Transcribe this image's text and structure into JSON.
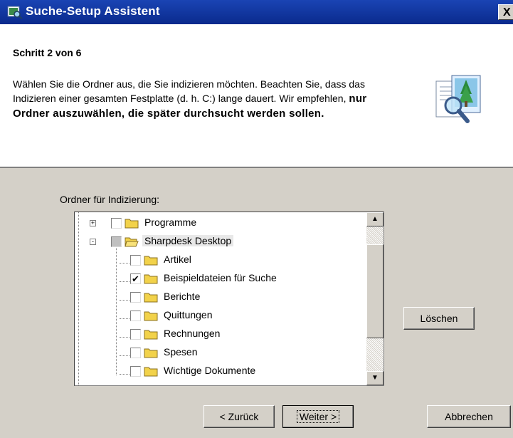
{
  "window": {
    "title": "Suche-Setup Assistent",
    "close_label": "X"
  },
  "header": {
    "step": "Schritt 2 von 6",
    "desc_normal": "Wählen Sie die Ordner aus, die Sie indizieren möchten. Beachten Sie, dass das Indizieren einer gesamten Festplatte (d. h. C:) lange dauert. Wir empfehlen, ",
    "desc_bold": "nur Ordner auszuwählen, die später durchsucht werden sollen."
  },
  "tree": {
    "label": "Ordner für Indizierung:",
    "items": [
      {
        "label": "Programme",
        "expander": "+",
        "checked": false,
        "partial": false,
        "level": 0
      },
      {
        "label": "Sharpdesk Desktop",
        "expander": "-",
        "checked": false,
        "partial": true,
        "level": 0,
        "selected": true
      },
      {
        "label": "Artikel",
        "checked": false,
        "level": 1
      },
      {
        "label": "Beispieldateien für Suche",
        "checked": true,
        "level": 1
      },
      {
        "label": "Berichte",
        "checked": false,
        "level": 1
      },
      {
        "label": "Quittungen",
        "checked": false,
        "level": 1
      },
      {
        "label": "Rechnungen",
        "checked": false,
        "level": 1
      },
      {
        "label": "Spesen",
        "checked": false,
        "level": 1
      },
      {
        "label": "Wichtige Dokumente",
        "checked": false,
        "level": 1
      }
    ]
  },
  "buttons": {
    "delete": "Löschen",
    "back": "< Zurück",
    "next": "Weiter >",
    "cancel": "Abbrechen"
  },
  "colors": {
    "titlebar": "#0a2a8c",
    "dialog_bg": "#d4d0c8",
    "folder": "#f2d24a"
  },
  "icons": {
    "app": "search-setup-app-icon",
    "wizard": "document-magnifier-icon",
    "folder": "folder-icon",
    "folder_open": "folder-open-icon"
  }
}
